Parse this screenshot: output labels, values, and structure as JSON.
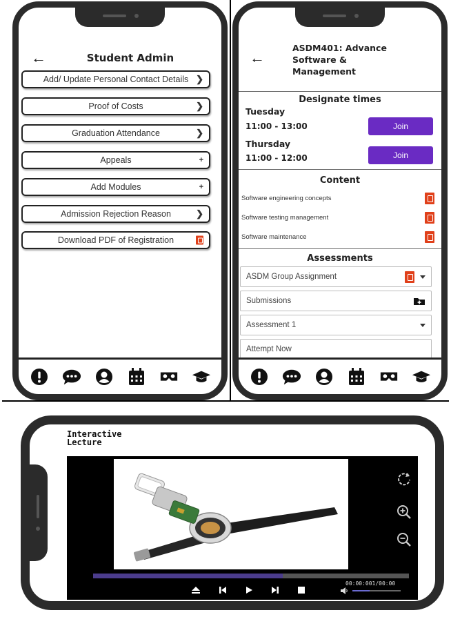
{
  "student_admin": {
    "title": "Student Admin",
    "buttons": [
      {
        "label": "Add/ Update Personal Contact Details",
        "icon": "chevron-right-icon",
        "glyph": "❯"
      },
      {
        "label": "Proof of Costs",
        "icon": "chevron-right-icon",
        "glyph": "❯"
      },
      {
        "label": "Graduation Attendance",
        "icon": "chevron-right-icon",
        "glyph": "❯"
      },
      {
        "label": "Appeals",
        "icon": "plus-icon",
        "glyph": "+"
      },
      {
        "label": "Add Modules",
        "icon": "plus-icon",
        "glyph": "+"
      },
      {
        "label": "Admission Rejection Reason",
        "icon": "chevron-right-icon",
        "glyph": "❯"
      },
      {
        "label": "Download PDF of Registration",
        "icon": "pdf-icon",
        "glyph": ""
      }
    ]
  },
  "module": {
    "title": "ASDM401: Advance Software & Management",
    "title_lines": [
      "ASDM401: Advance",
      "Software &",
      "Management"
    ],
    "designate_title": "Designate times",
    "sessions": [
      {
        "day": "Tuesday",
        "time": "11:00 - 13:00",
        "join_label": "Join"
      },
      {
        "day": "Thursday",
        "time": "11:00 - 12:00",
        "join_label": "Join"
      }
    ],
    "content_title": "Content",
    "content_items": [
      "Software engineering concepts",
      "Software testing management",
      "Software maintenance"
    ],
    "assessments_title": "Assessments",
    "assessments": [
      {
        "label": "ASDM Group Assignment",
        "icons": [
          "pdf-icon",
          "chevron-down-icon"
        ]
      },
      {
        "label": "Submissions",
        "icons": [
          "folder-plus-icon"
        ]
      },
      {
        "label": "Assessment 1",
        "icons": [
          "chevron-down-icon"
        ]
      },
      {
        "label": "Attempt Now",
        "icons": []
      }
    ]
  },
  "nav_icons": [
    "exclamation-icon",
    "chat-icon",
    "user-icon",
    "calendar-icon",
    "vr-headset-icon",
    "graduation-cap-icon"
  ],
  "lecture": {
    "title_line1": "Interactive",
    "title_line2": "Lecture",
    "timecode": "00:00:001/00:00",
    "progress": 0.6,
    "volume": 0.35,
    "controls": [
      "eject-icon",
      "skip-back-icon",
      "play-icon",
      "skip-forward-icon",
      "stop-icon",
      "volume-icon"
    ],
    "tools": [
      "refresh-icon",
      "zoom-in-icon",
      "zoom-out-icon"
    ]
  },
  "colors": {
    "accent": "#6a2bc3",
    "pdf": "#e0401a",
    "frame": "#2b2b2b",
    "progress": "#4b3c8c"
  }
}
